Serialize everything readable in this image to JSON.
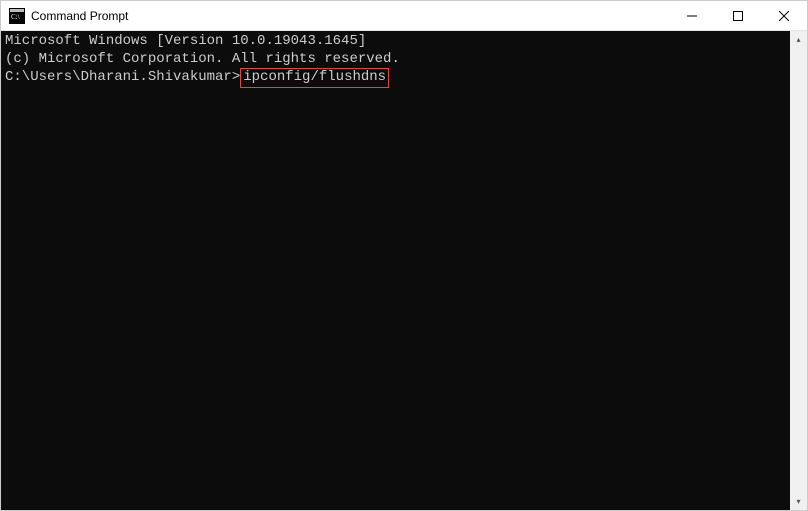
{
  "titlebar": {
    "title": "Command Prompt",
    "icon": "cmd-icon"
  },
  "window_controls": {
    "minimize": "minimize",
    "maximize": "maximize",
    "close": "close"
  },
  "terminal": {
    "line1": "Microsoft Windows [Version 10.0.19043.1645]",
    "line2": "(c) Microsoft Corporation. All rights reserved.",
    "blank": "",
    "prompt": "C:\\Users\\Dharani.Shivakumar>",
    "command": "ipconfig/flushdns"
  },
  "scrollbar": {
    "up": "▴",
    "down": "▾"
  }
}
